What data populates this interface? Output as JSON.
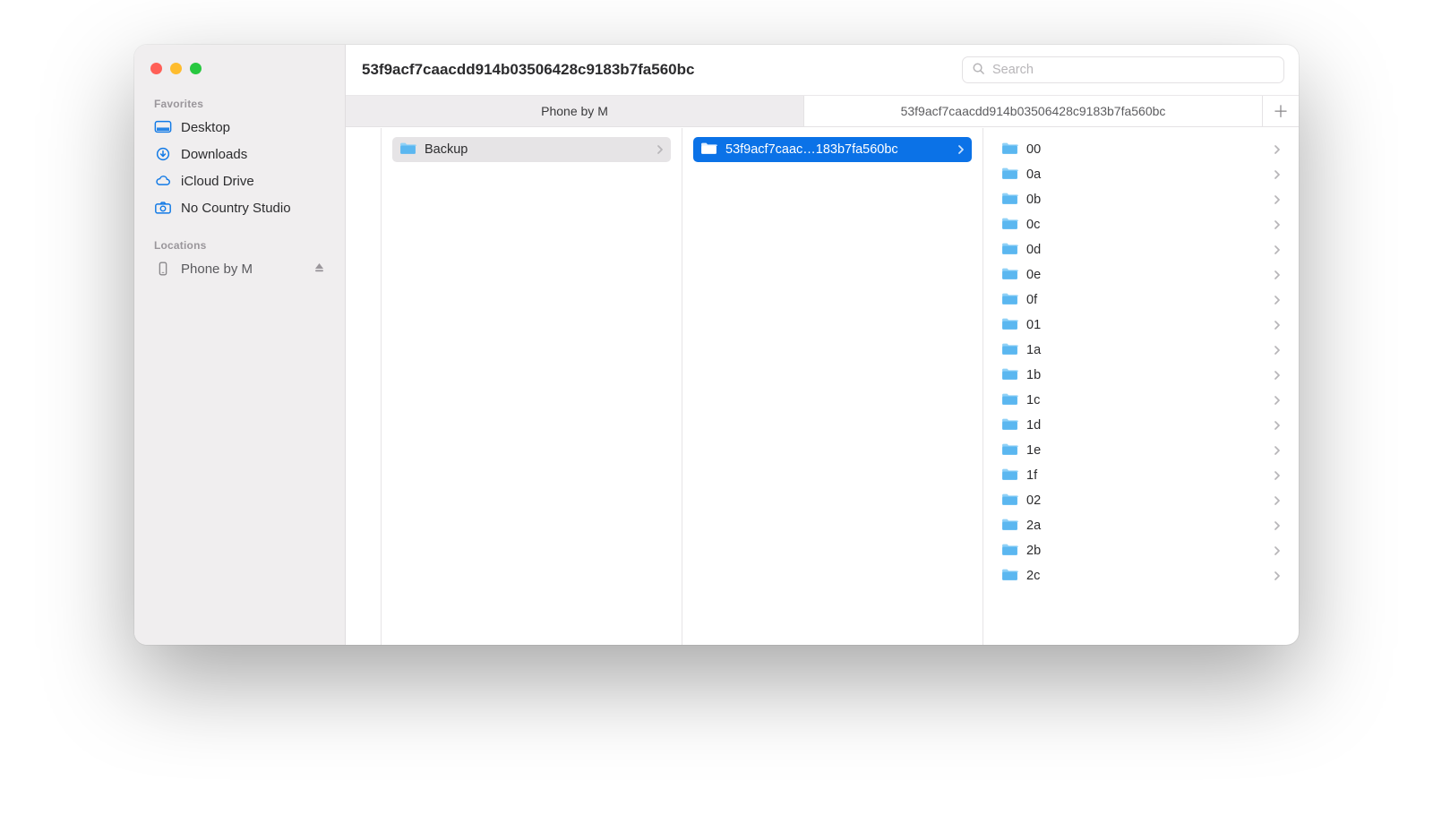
{
  "window": {
    "title": "53f9acf7caacdd914b03506428c9183b7fa560bc"
  },
  "search": {
    "placeholder": "Search",
    "value": ""
  },
  "sidebar": {
    "sections": [
      {
        "label": "Favorites",
        "items": [
          {
            "icon": "desktop",
            "label": "Desktop"
          },
          {
            "icon": "download",
            "label": "Downloads"
          },
          {
            "icon": "cloud",
            "label": "iCloud Drive"
          },
          {
            "icon": "camera",
            "label": "No Country Studio"
          }
        ]
      },
      {
        "label": "Locations",
        "items": [
          {
            "icon": "phone",
            "label": "Phone by M",
            "ejectable": true
          }
        ]
      }
    ]
  },
  "tabs": {
    "items": [
      {
        "label": "Phone by M",
        "active": true
      },
      {
        "label": "53f9acf7caacdd914b03506428c9183b7fa560bc",
        "active": false
      }
    ]
  },
  "columns": {
    "c1": [
      {
        "label": "Backup",
        "state": "gray"
      }
    ],
    "c2": [
      {
        "label": "53f9acf7caac…183b7fa560bc",
        "state": "blue"
      }
    ],
    "c3": [
      {
        "label": "00"
      },
      {
        "label": "0a"
      },
      {
        "label": "0b"
      },
      {
        "label": "0c"
      },
      {
        "label": "0d"
      },
      {
        "label": "0e"
      },
      {
        "label": "0f"
      },
      {
        "label": "01"
      },
      {
        "label": "1a"
      },
      {
        "label": "1b"
      },
      {
        "label": "1c"
      },
      {
        "label": "1d"
      },
      {
        "label": "1e"
      },
      {
        "label": "1f"
      },
      {
        "label": "02"
      },
      {
        "label": "2a"
      },
      {
        "label": "2b"
      },
      {
        "label": "2c"
      }
    ]
  }
}
